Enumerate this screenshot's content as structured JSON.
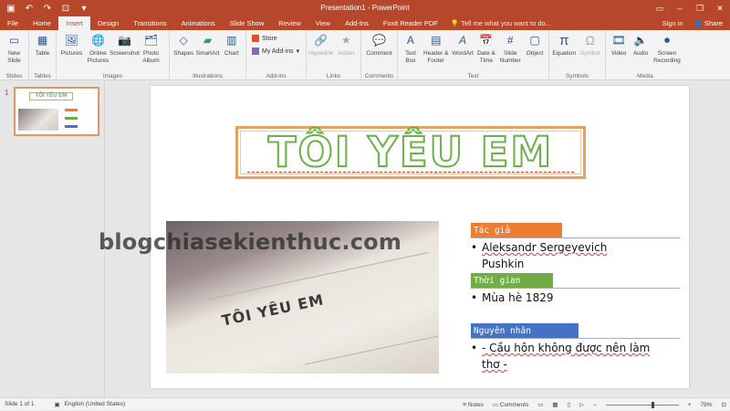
{
  "window": {
    "title": "Presentation1 - PowerPoint",
    "qat": [
      "save-icon",
      "undo-icon",
      "redo-icon",
      "start-icon",
      "customize-icon"
    ],
    "controls": [
      "ribbon-options-icon",
      "minimize-icon",
      "restore-icon",
      "close-icon"
    ]
  },
  "tabs": [
    "File",
    "Home",
    "Insert",
    "Design",
    "Transitions",
    "Animations",
    "Slide Show",
    "Review",
    "View",
    "Add-Ins",
    "Foxit Reader PDF"
  ],
  "active_tab": "Insert",
  "tell_me": "Tell me what you want to do...",
  "sign_in": "Sign in",
  "share": "Share",
  "ribbon": {
    "slides": {
      "label": "Slides",
      "new_slide": "New Slide"
    },
    "tables": {
      "label": "Tables",
      "table": "Table"
    },
    "images": {
      "label": "Images",
      "pictures": "Pictures",
      "online_pictures": "Online Pictures",
      "screenshot": "Screenshot",
      "photo_album": "Photo Album"
    },
    "illustrations": {
      "label": "Illustrations",
      "shapes": "Shapes",
      "smartart": "SmartArt",
      "chart": "Chart"
    },
    "addins": {
      "label": "Add-ins",
      "store": "Store",
      "my_addins": "My Add-ins"
    },
    "links": {
      "label": "Links",
      "hyperlink": "Hyperlink",
      "action": "Action"
    },
    "comments": {
      "label": "Comments",
      "comment": "Comment"
    },
    "text": {
      "label": "Text",
      "text_box": "Text Box",
      "header_footer": "Header & Footer",
      "wordart": "WordArt",
      "date_time": "Date & Time",
      "slide_number": "Slide Number",
      "object": "Object"
    },
    "symbols": {
      "label": "Symbols",
      "equation": "Equation",
      "symbol": "Symbol"
    },
    "media": {
      "label": "Media",
      "video": "Video",
      "audio": "Audio",
      "screen_recording": "Screen Recording"
    }
  },
  "thumbnail": {
    "number": "1",
    "title": "TÔI YÊU EM"
  },
  "slide": {
    "title": "TÔI YÊU EM",
    "photo_text": "TÔI YÊU EM",
    "watermark": "blogchiasekienthuc.com",
    "sections": [
      {
        "header": "Tác giả",
        "color": "#ed7d31",
        "lines": [
          "Aleksandr Sergeyevich",
          "Pushkin"
        ]
      },
      {
        "header": "Thời gian",
        "color": "#70ad47",
        "lines": [
          "Mùa hè 1829"
        ]
      },
      {
        "header": "Nguyên nhân",
        "color": "#4472c4",
        "lines": [
          "- Cầu hôn không được nên làm",
          "thơ -"
        ]
      }
    ]
  },
  "status": {
    "slide_of": "Slide 1 of 1",
    "language": "English (United States)",
    "notes": "Notes",
    "comments": "Comments",
    "zoom": "79%"
  },
  "colors": {
    "ppt_red": "#b7472a",
    "title_green": "#6bb04a",
    "title_border": "#e5a25d"
  }
}
